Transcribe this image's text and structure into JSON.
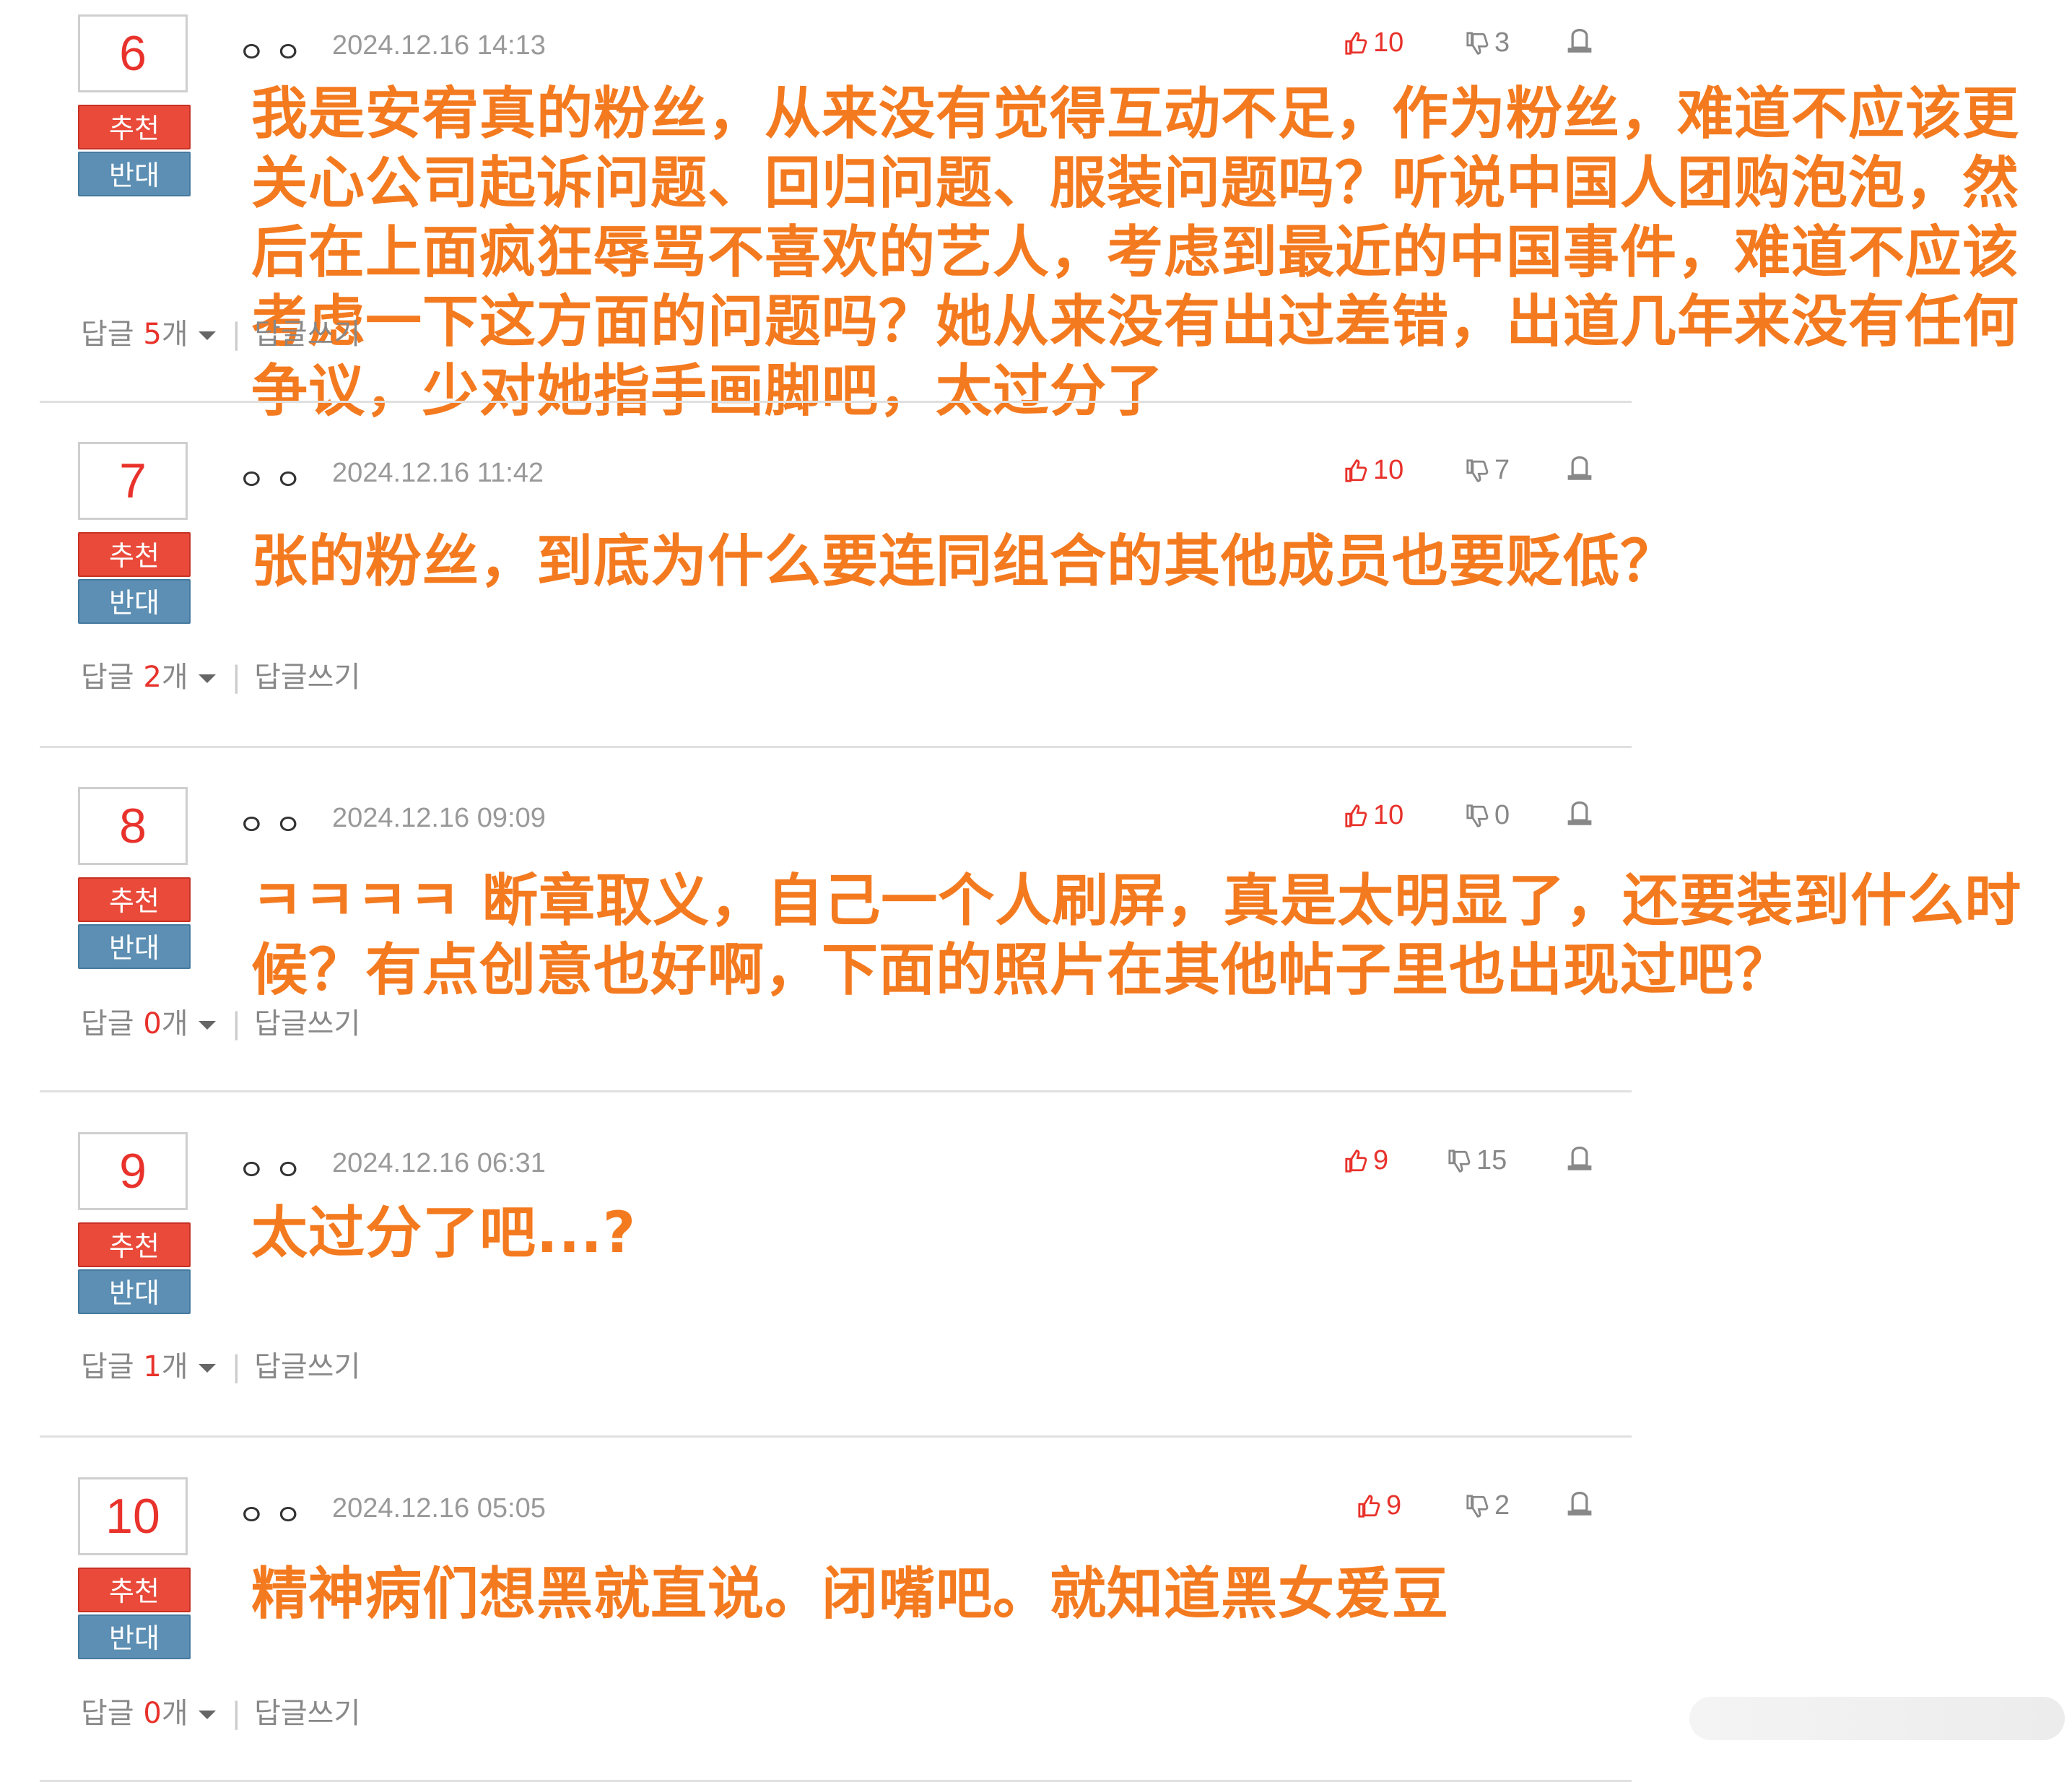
{
  "labels": {
    "recommend": "추천",
    "oppose": "반대",
    "reply_prefix": "답글 ",
    "reply_suffix": "개",
    "write_reply": "답글쓰기",
    "user_mark": "ㅇㅇ"
  },
  "comments": [
    {
      "rank": "6",
      "timestamp": "2024.12.16 14:13",
      "likes": "10",
      "dislikes": "3",
      "reply_count": "5",
      "text": "我是安宥真的粉丝，从来没有觉得互动不足，作为粉丝，难道不应该更关心公司起诉问题、回归问题、服装问题吗？听说中国人团购泡泡，然后在上面疯狂辱骂不喜欢的艺人，考虑到最近的中国事件，难道不应该考虑一下这方面的问题吗？她从来没有出过差错，出道几年来没有任何争议，少对她指手画脚吧，太过分了"
    },
    {
      "rank": "7",
      "timestamp": "2024.12.16 11:42",
      "likes": "10",
      "dislikes": "7",
      "reply_count": "2",
      "text": "张的粉丝，到底为什么要连同组合的其他成员也要贬低？"
    },
    {
      "rank": "8",
      "timestamp": "2024.12.16 09:09",
      "likes": "10",
      "dislikes": "0",
      "reply_count": "0",
      "text": "ㅋㅋㅋㅋ 断章取义，自己一个人刷屏，真是太明显了，还要装到什么时候？有点创意也好啊，下面的照片在其他帖子里也出现过吧？"
    },
    {
      "rank": "9",
      "timestamp": "2024.12.16 06:31",
      "likes": "9",
      "dislikes": "15",
      "reply_count": "1",
      "text": "太过分了吧...?"
    },
    {
      "rank": "10",
      "timestamp": "2024.12.16 05:05",
      "likes": "9",
      "dislikes": "2",
      "reply_count": "0",
      "text": "精神病们想黑就直说。闭嘴吧。就知道黑女爱豆"
    }
  ],
  "colors": {
    "overlay_text": "#f47a20",
    "rank_number": "#e8322b",
    "recommend_button": "#e94a3a",
    "oppose_button": "#5c8fb3",
    "timestamp": "#999999"
  },
  "icons": [
    "thumbs-up-icon",
    "thumbs-down-icon",
    "report-icon",
    "caret-down-icon"
  ]
}
